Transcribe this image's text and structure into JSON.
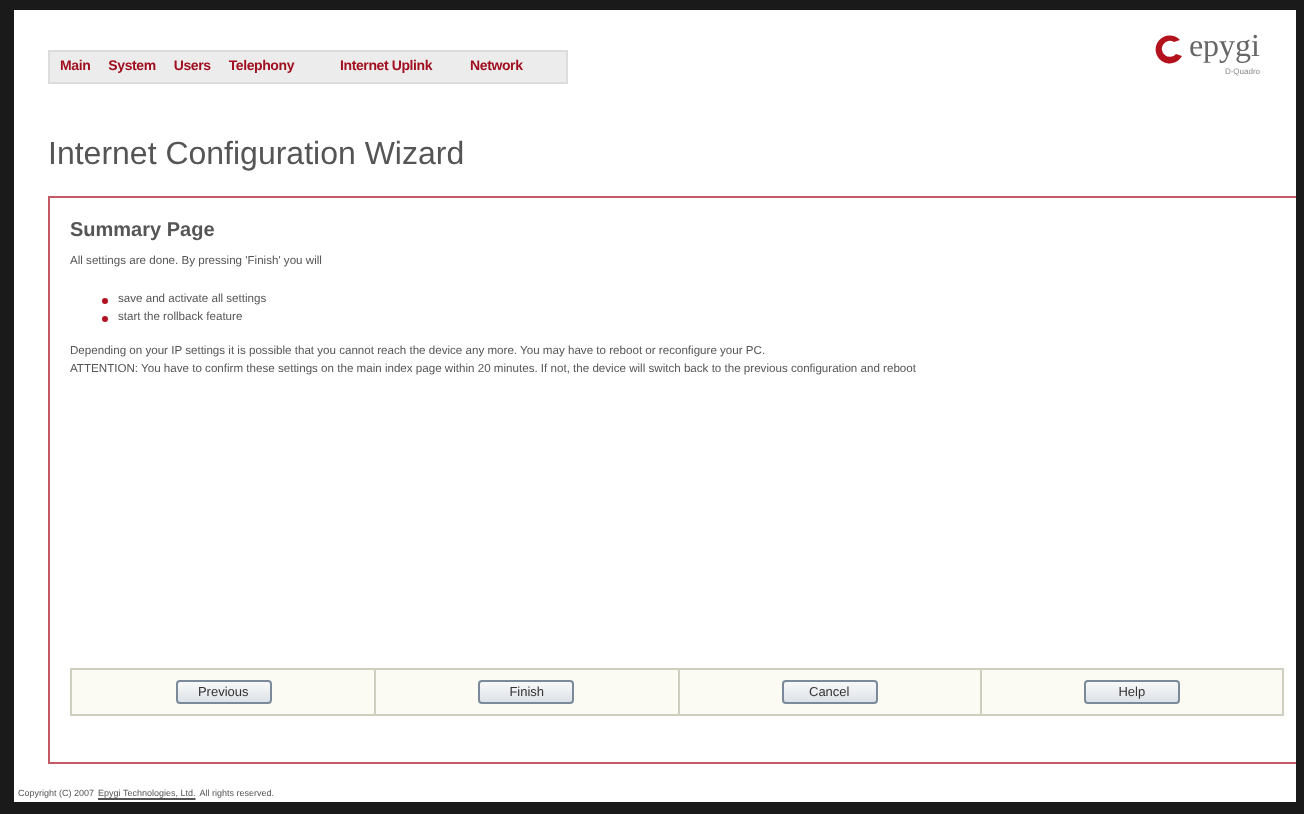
{
  "nav": {
    "items": [
      "Main",
      "System",
      "Users",
      "Telephony",
      "Internet Uplink",
      "Network"
    ]
  },
  "logo": {
    "name": "epygi",
    "subtitle": "D-Quadro"
  },
  "title": "Internet Configuration Wizard",
  "panel": {
    "heading": "Summary Page",
    "intro": "All settings are done. By pressing 'Finish' you will",
    "bullets": [
      "save and activate all settings",
      "start the rollback feature"
    ],
    "notes": [
      "Depending on your IP settings it is possible that you cannot reach the device any more. You may have to reboot or reconfigure your PC.",
      "ATTENTION: You have to confirm these settings on the main index page within 20 minutes. If not, the device will switch back to the previous configuration and reboot"
    ],
    "buttons": [
      "Previous",
      "Finish",
      "Cancel",
      "Help"
    ]
  },
  "footer": {
    "prefix": "Copyright (C) 2007",
    "link": "Epygi Technologies, Ltd.",
    "suffix": "All rights reserved."
  }
}
